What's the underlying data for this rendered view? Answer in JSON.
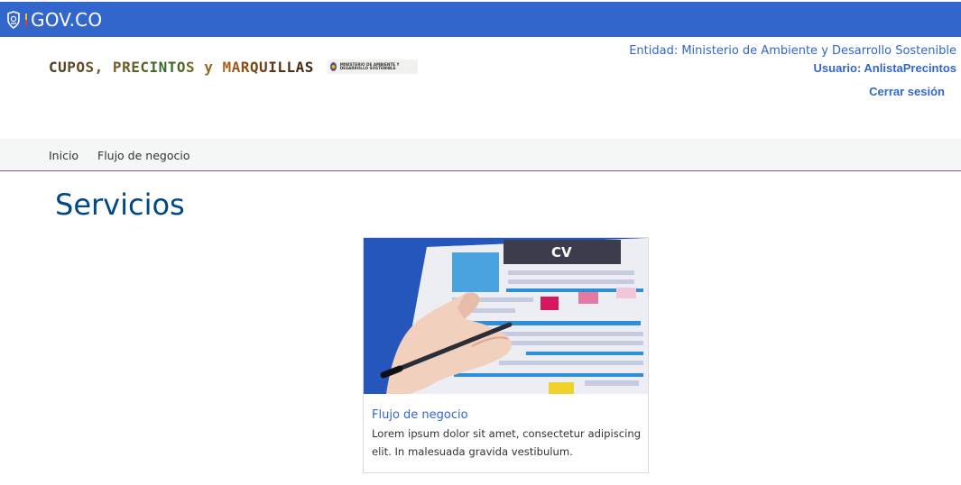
{
  "gov_bar": {
    "logo_text": "GOV.CO",
    "color": "#3366cc"
  },
  "header": {
    "brand_text": "CUPOS, PRECINTOS y MARQUILLAS",
    "ministry_logo_text": "MINISTERIO DE AMBIENTE Y DESARROLLO SOSTENIBLE",
    "entity": "Entidad: Ministerio de Ambiente y Desarrollo Sostenible",
    "user": "Usuario: AnlistaPrecintos",
    "logout": "Cerrar sesión"
  },
  "nav": {
    "items": [
      {
        "label": "Inicio"
      },
      {
        "label": "Flujo de negocio"
      }
    ]
  },
  "main": {
    "title": "Servicios",
    "cards": [
      {
        "image_text": "CV",
        "title": "Flujo de negocio",
        "description": "Lorem ipsum dolor sit amet, consectetur adipiscing elit. In malesuada gravida vestibulum."
      }
    ]
  },
  "colors": {
    "accent": "#3366cc",
    "title": "#004884",
    "nav_border": "#a8429a"
  }
}
